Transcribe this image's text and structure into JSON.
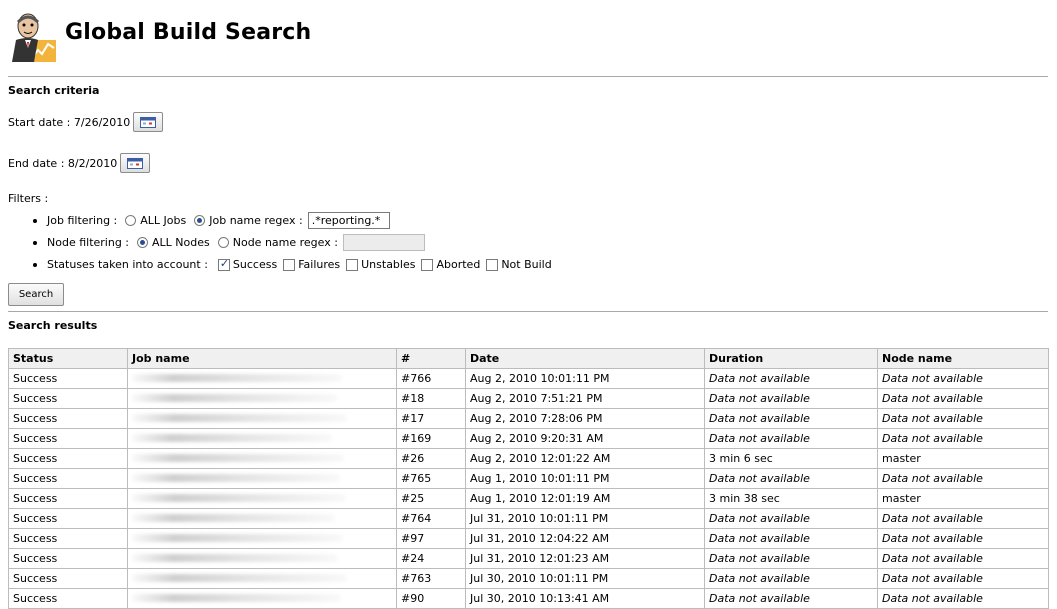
{
  "header": {
    "title": "Global Build Search",
    "logo_icon": "butler-logo"
  },
  "search_criteria": {
    "title": "Search criteria",
    "start_date": {
      "label": "Start date : 7/26/2010",
      "calendar_icon": "calendar-icon"
    },
    "end_date": {
      "label": "End date : 8/2/2010",
      "calendar_icon": "calendar-icon"
    },
    "filters_label": "Filters :",
    "job_filtering": {
      "label": "Job filtering :",
      "all_label": "ALL Jobs",
      "regex_label": "Job name regex :",
      "regex_value": ".*reporting.*",
      "selected": "regex"
    },
    "node_filtering": {
      "label": "Node filtering :",
      "all_label": "ALL Nodes",
      "regex_label": "Node name regex :",
      "regex_value": "",
      "selected": "all"
    },
    "statuses": {
      "label": "Statuses taken into account :",
      "options": [
        {
          "label": "Success",
          "checked": true
        },
        {
          "label": "Failures",
          "checked": false
        },
        {
          "label": "Unstables",
          "checked": false
        },
        {
          "label": "Aborted",
          "checked": false
        },
        {
          "label": "Not Build",
          "checked": false
        }
      ]
    },
    "search_button": "Search"
  },
  "results": {
    "title": "Search results",
    "columns": [
      "Status",
      "Job name",
      "#",
      "Date",
      "Duration",
      "Node name"
    ],
    "rows": [
      {
        "status": "Success",
        "number": "#766",
        "date": "Aug 2, 2010 10:01:11 PM",
        "duration": "Data not available",
        "node": "Data not available"
      },
      {
        "status": "Success",
        "number": "#18",
        "date": "Aug 2, 2010 7:51:21 PM",
        "duration": "Data not available",
        "node": "Data not available"
      },
      {
        "status": "Success",
        "number": "#17",
        "date": "Aug 2, 2010 7:28:06 PM",
        "duration": "Data not available",
        "node": "Data not available"
      },
      {
        "status": "Success",
        "number": "#169",
        "date": "Aug 2, 2010 9:20:31 AM",
        "duration": "Data not available",
        "node": "Data not available"
      },
      {
        "status": "Success",
        "number": "#26",
        "date": "Aug 2, 2010 12:01:22 AM",
        "duration": "3 min 6 sec",
        "node": "master"
      },
      {
        "status": "Success",
        "number": "#765",
        "date": "Aug 1, 2010 10:01:11 PM",
        "duration": "Data not available",
        "node": "Data not available"
      },
      {
        "status": "Success",
        "number": "#25",
        "date": "Aug 1, 2010 12:01:19 AM",
        "duration": "3 min 38 sec",
        "node": "master"
      },
      {
        "status": "Success",
        "number": "#764",
        "date": "Jul 31, 2010 10:01:11 PM",
        "duration": "Data not available",
        "node": "Data not available"
      },
      {
        "status": "Success",
        "number": "#97",
        "date": "Jul 31, 2010 12:04:22 AM",
        "duration": "Data not available",
        "node": "Data not available"
      },
      {
        "status": "Success",
        "number": "#24",
        "date": "Jul 31, 2010 12:01:23 AM",
        "duration": "Data not available",
        "node": "Data not available"
      },
      {
        "status": "Success",
        "number": "#763",
        "date": "Jul 30, 2010 10:01:11 PM",
        "duration": "Data not available",
        "node": "Data not available"
      },
      {
        "status": "Success",
        "number": "#90",
        "date": "Jul 30, 2010 10:13:41 AM",
        "duration": "Data not available",
        "node": "Data not available"
      }
    ]
  }
}
